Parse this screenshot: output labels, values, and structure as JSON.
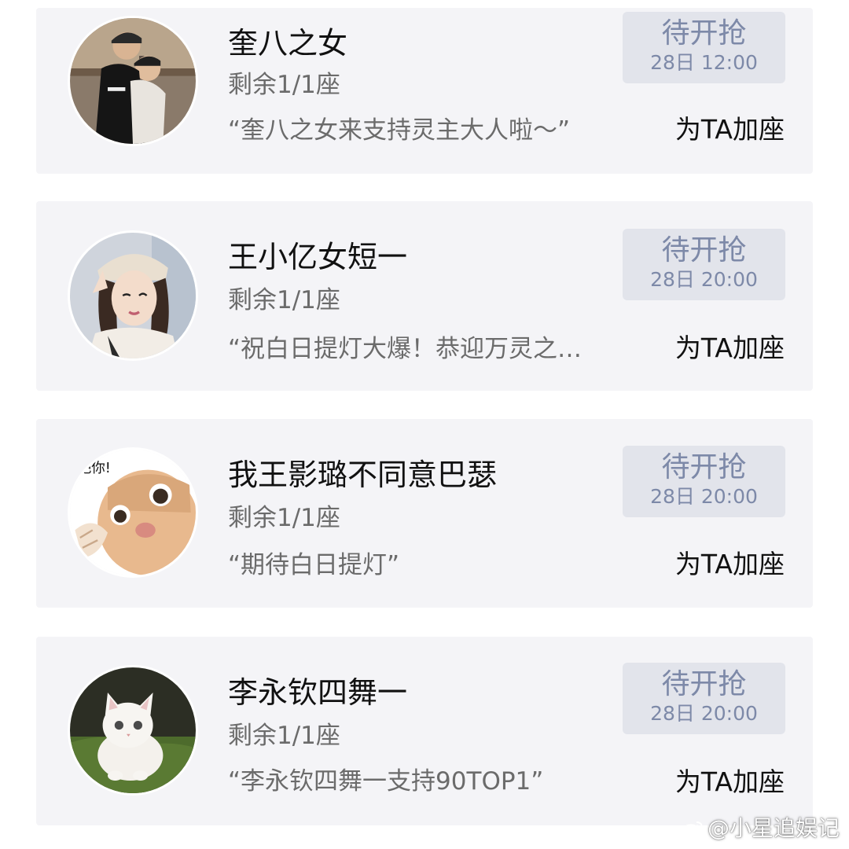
{
  "items": [
    {
      "name": "奎八之女",
      "seats": "剩余1/1座",
      "message": "“奎八之女来支持灵主大人啦～”",
      "status": "待开抢",
      "time": "28日 12:00",
      "action": "为TA加座",
      "avatar_icon": "couple-photo"
    },
    {
      "name": "王小亿女短一",
      "seats": "剩余1/1座",
      "message": "“祝白日提灯大爆！恭迎万灵之…",
      "status": "待开抢",
      "time": "28日 20:00",
      "action": "为TA加座",
      "avatar_icon": "girl-photo"
    },
    {
      "name": "我王影璐不同意巴瑟",
      "seats": "剩余1/1座",
      "message": "“期待白日提灯”",
      "status": "待开抢",
      "time": "28日 20:00",
      "action": "为TA加座",
      "avatar_icon": "cat-meme",
      "avatar_text": "吧你!"
    },
    {
      "name": "李永钦四舞一",
      "seats": "剩余1/1座",
      "message": "“李永钦四舞一支持90TOP1”",
      "status": "待开抢",
      "time": "28日 20:00",
      "action": "为TA加座",
      "avatar_icon": "white-kitten"
    }
  ],
  "watermark": "@小星追娱记",
  "colors": {
    "card_bg": "#f4f4f7",
    "status_bg": "#e2e4eb",
    "status_text": "#7d89a8",
    "secondary_text": "#6b6b6b",
    "primary_text": "#111111"
  }
}
